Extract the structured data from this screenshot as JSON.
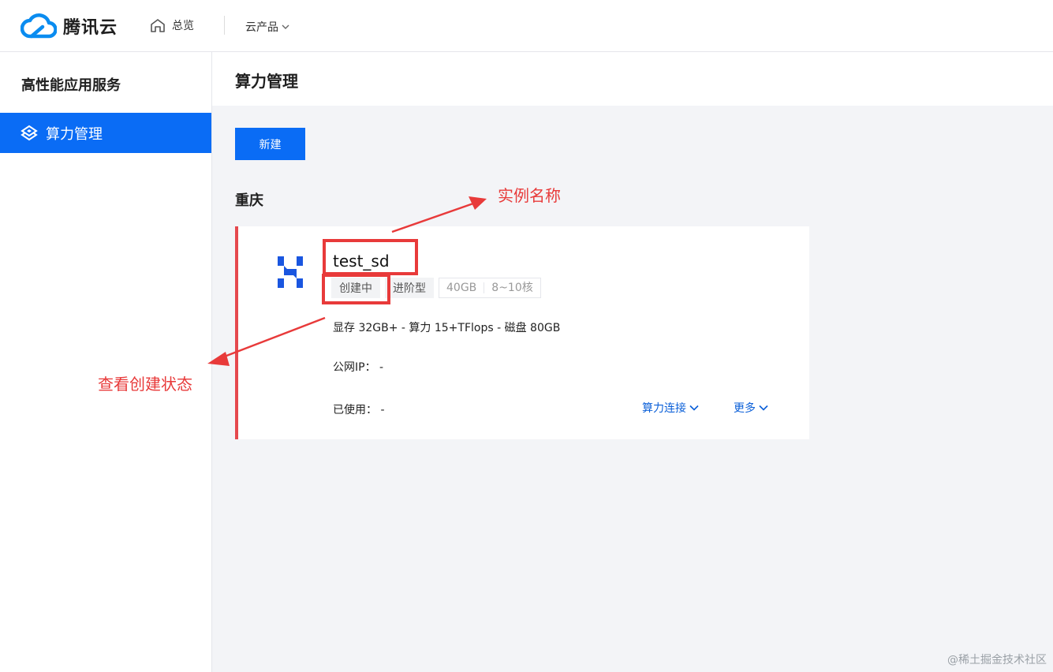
{
  "topbar": {
    "brand": "腾讯云",
    "overview": "总览",
    "products": "云产品"
  },
  "sidebar": {
    "title": "高性能应用服务",
    "items": [
      {
        "label": "算力管理"
      }
    ]
  },
  "page": {
    "title": "算力管理",
    "new_button": "新建",
    "region": "重庆"
  },
  "instance": {
    "name": "test_sd",
    "status": "创建中",
    "type": "进阶型",
    "gpu_mem": "40GB",
    "cores": "8~10核",
    "spec": "显存 32GB+ - 算力 15+TFlops - 磁盘 80GB",
    "public_ip": "公网IP： -",
    "used": "已使用： -",
    "connect_action": "算力连接",
    "more_action": "更多"
  },
  "annotations": {
    "name_label": "实例名称",
    "status_label": "查看创建状态"
  },
  "watermark": "@稀土掘金技术社区",
  "colors": {
    "primary": "#0a6cf5",
    "annotation": "#e83a3a",
    "link": "#0a5fd8"
  }
}
